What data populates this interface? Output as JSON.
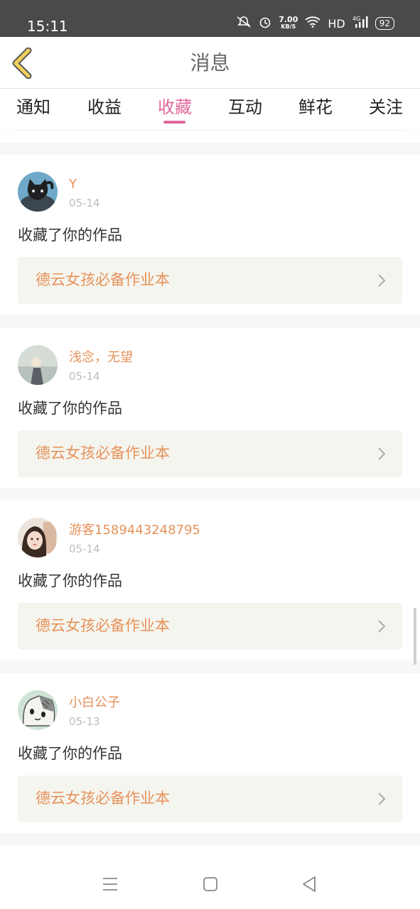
{
  "status_bar": {
    "time": "15:11",
    "speed_value": "7.00",
    "speed_unit": "KB/S",
    "hd": "HD",
    "network": "4G",
    "battery": "92"
  },
  "header": {
    "title": "消息"
  },
  "tabs": [
    {
      "label": "通知",
      "active": false
    },
    {
      "label": "收益",
      "active": false
    },
    {
      "label": "收藏",
      "active": true
    },
    {
      "label": "互动",
      "active": false
    },
    {
      "label": "鲜花",
      "active": false
    },
    {
      "label": "关注",
      "active": false
    }
  ],
  "messages": [
    {
      "user": "Y",
      "date": "05-14",
      "text": "收藏了你的作品",
      "work": "德云女孩必备作业本",
      "avatar_icon": "black-cat-avatar"
    },
    {
      "user": "浅念，无望",
      "date": "05-14",
      "text": "收藏了你的作品",
      "work": "德云女孩必备作业本",
      "avatar_icon": "girl-photo-avatar"
    },
    {
      "user": "游客1589443248795",
      "date": "05-14",
      "text": "收藏了你的作品",
      "work": "德云女孩必备作业本",
      "avatar_icon": "girl-portrait-avatar"
    },
    {
      "user": "小白公子",
      "date": "05-13",
      "text": "收藏了你的作品",
      "work": "德云女孩必备作业本",
      "avatar_icon": "cartoon-cat-avatar"
    }
  ],
  "colors": {
    "accent_pink": "#e0679c",
    "name_orange": "#e6925a",
    "back_yellow": "#f2d15a"
  }
}
